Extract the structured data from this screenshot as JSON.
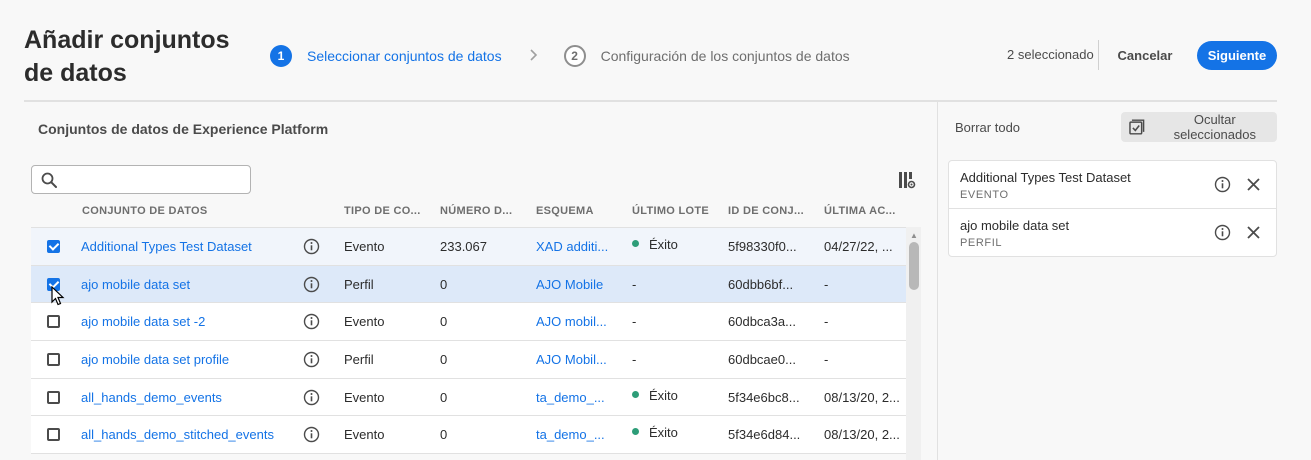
{
  "header": {
    "title": "Añadir conjuntos de datos",
    "steps": [
      {
        "number": "1",
        "label": "Seleccionar conjuntos de datos"
      },
      {
        "number": "2",
        "label": "Configuración de los conjuntos de datos"
      }
    ],
    "selected_count": "2 seleccionado",
    "cancel_label": "Cancelar",
    "next_label": "Siguiente"
  },
  "left_panel": {
    "title": "Conjuntos de datos de Experience Platform",
    "search_placeholder": "",
    "columns": [
      "CONJUNTO DE DATOS",
      "TIPO DE CO...",
      "NÚMERO D...",
      "ESQUEMA",
      "ÚLTIMO LOTE",
      "ID DE CONJ...",
      "ÚLTIMA AC..."
    ],
    "rows": [
      {
        "name": "Additional Types Test Dataset",
        "type": "Evento",
        "count": "233.067",
        "schema": "XAD additi...",
        "last_batch": "Éxito",
        "id": "5f98330f0...",
        "last_updated": "04/27/22, ...",
        "checked": true
      },
      {
        "name": "ajo mobile data set",
        "type": "Perfil",
        "count": "0",
        "schema": "AJO Mobile",
        "last_batch": "-",
        "id": "60dbb6bf...",
        "last_updated": "-",
        "checked": true
      },
      {
        "name": "ajo mobile data set -2",
        "type": "Evento",
        "count": "0",
        "schema": "AJO mobil...",
        "last_batch": "-",
        "id": "60dbca3a...",
        "last_updated": "-",
        "checked": false
      },
      {
        "name": "ajo mobile data set profile",
        "type": "Perfil",
        "count": "0",
        "schema": "AJO Mobil...",
        "last_batch": "-",
        "id": "60dbcae0...",
        "last_updated": "-",
        "checked": false
      },
      {
        "name": "all_hands_demo_events",
        "type": "Evento",
        "count": "0",
        "schema": "ta_demo_...",
        "last_batch": "Éxito",
        "id": "5f34e6bc8...",
        "last_updated": "08/13/20, 2...",
        "checked": false
      },
      {
        "name": "all_hands_demo_stitched_events",
        "type": "Evento",
        "count": "0",
        "schema": "ta_demo_...",
        "last_batch": "Éxito",
        "id": "5f34e6d84...",
        "last_updated": "08/13/20, 2...",
        "checked": false
      }
    ]
  },
  "right_panel": {
    "clear_all_label": "Borrar todo",
    "hide_selected_label": "Ocultar seleccionados",
    "selected": [
      {
        "name": "Additional Types Test Dataset",
        "type": "EVENTO"
      },
      {
        "name": "ajo mobile data set",
        "type": "PERFIL"
      }
    ]
  },
  "colors": {
    "accent": "#1473e6",
    "success": "#2d9d78",
    "selected_row": "#dde9f9"
  }
}
